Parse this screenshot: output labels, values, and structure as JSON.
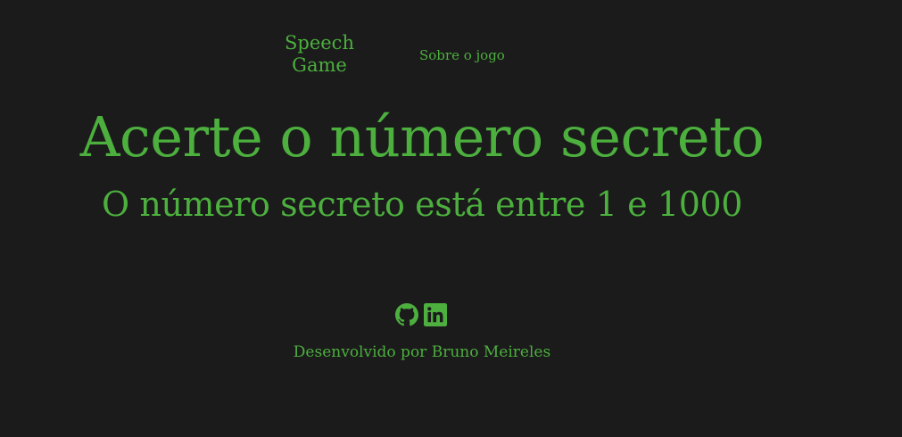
{
  "header": {
    "logo": {
      "line1": "Speech",
      "line2": "Game"
    },
    "nav": {
      "about_label": "Sobre o jogo"
    }
  },
  "main": {
    "title": "Acerte o número secreto",
    "subtitle": "O número secreto está entre 1 e 1000"
  },
  "footer": {
    "social": [
      {
        "icon": "github-icon"
      },
      {
        "icon": "linkedin-icon"
      }
    ],
    "credit": "Desenvolvido por Bruno Meireles"
  },
  "colors": {
    "background": "#1b1b1b",
    "accent": "#4caf3e"
  }
}
